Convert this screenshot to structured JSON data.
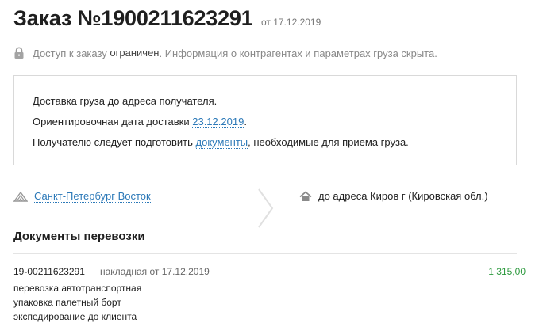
{
  "order": {
    "title": "Заказ №1900211623291",
    "date_label": "от 17.12.2019"
  },
  "access": {
    "prefix": "Доступ к заказу ",
    "status_link": "ограничен",
    "suffix": ". Информация о контрагентах и параметрах груза скрыта."
  },
  "info": {
    "line1": "Доставка груза до адреса получателя.",
    "line2_prefix": "Ориентировочная дата доставки ",
    "delivery_date": "23.12.2019",
    "line2_suffix": ".",
    "line3_prefix": "Получателю следует подготовить ",
    "documents_link": "документы",
    "line3_suffix": ", необходимые для приема груза."
  },
  "route": {
    "from_label": "Санкт-Петербург Восток",
    "to_label": "до адреса Киров г (Кировская обл.)"
  },
  "documents_section": {
    "title": "Документы перевозки",
    "items": [
      {
        "number": "19-00211623291",
        "type": "накладная от 17.12.2019",
        "amount": "1 315,00",
        "services": [
          "перевозка автотранспортная",
          "упаковка палетный борт",
          "экспедирование до клиента"
        ]
      }
    ]
  },
  "colors": {
    "link": "#2c79b8",
    "amount": "#2e9a3f",
    "muted": "#888888"
  }
}
